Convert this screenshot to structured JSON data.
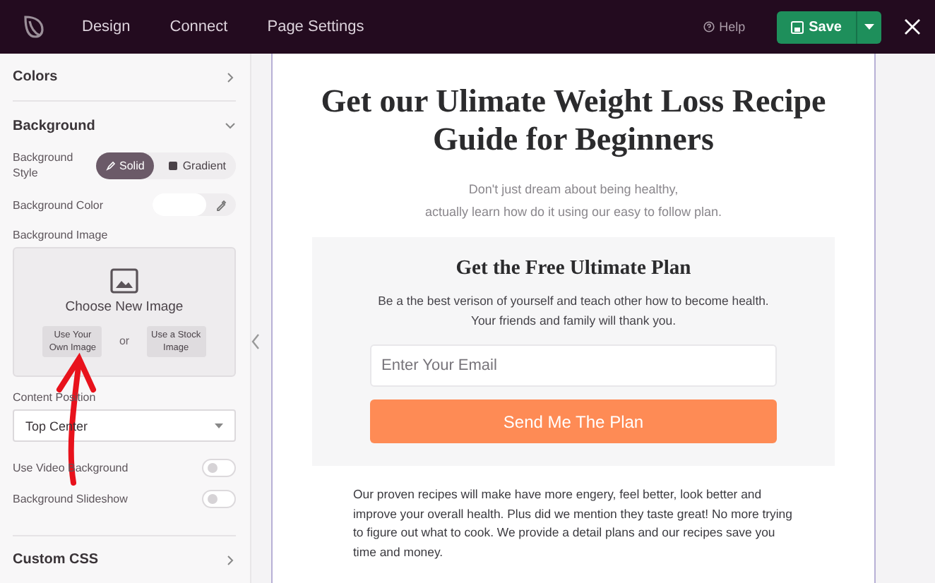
{
  "topbar": {
    "nav": [
      {
        "label": "Design"
      },
      {
        "label": "Connect"
      },
      {
        "label": "Page Settings"
      }
    ],
    "help": "Help",
    "save": "Save"
  },
  "sidebar": {
    "colors": {
      "title": "Colors",
      "expanded": false
    },
    "background": {
      "title": "Background",
      "expanded": true,
      "style_label": "Background Style",
      "style_options": [
        {
          "label": "Solid",
          "selected": true
        },
        {
          "label": "Gradient",
          "selected": false
        }
      ],
      "color_label": "Background Color",
      "image_label": "Background Image",
      "image_picker": {
        "title": "Choose New Image",
        "own": "Use Your Own Image",
        "or": "or",
        "stock": "Use a Stock Image"
      },
      "position_label": "Content Position",
      "position_value": "Top Center",
      "toggles": [
        {
          "label": "Use Video Background",
          "on": false
        },
        {
          "label": "Background Slideshow",
          "on": false
        }
      ]
    },
    "custom_css": {
      "title": "Custom CSS",
      "expanded": false
    }
  },
  "page": {
    "headline": "Get our Ulimate Weight Loss Recipe Guide for Beginners",
    "subtitle_lines": [
      "Don't just dream about being healthy,",
      "actually learn how do it using our easy to follow plan."
    ],
    "card": {
      "title": "Get the Free Ultimate Plan",
      "text": "Be a the best verison of yourself and teach other how to become health. Your friends and family will thank you.",
      "email_placeholder": "Enter Your Email",
      "button": "Send Me The Plan"
    },
    "paragraph": "Our proven recipes will make have more engery, feel better, look better and improve your overall health. Plus did we mention they taste great! No more trying to figure out what to cook. We provide a detail plans and our recipes save you time and money."
  }
}
